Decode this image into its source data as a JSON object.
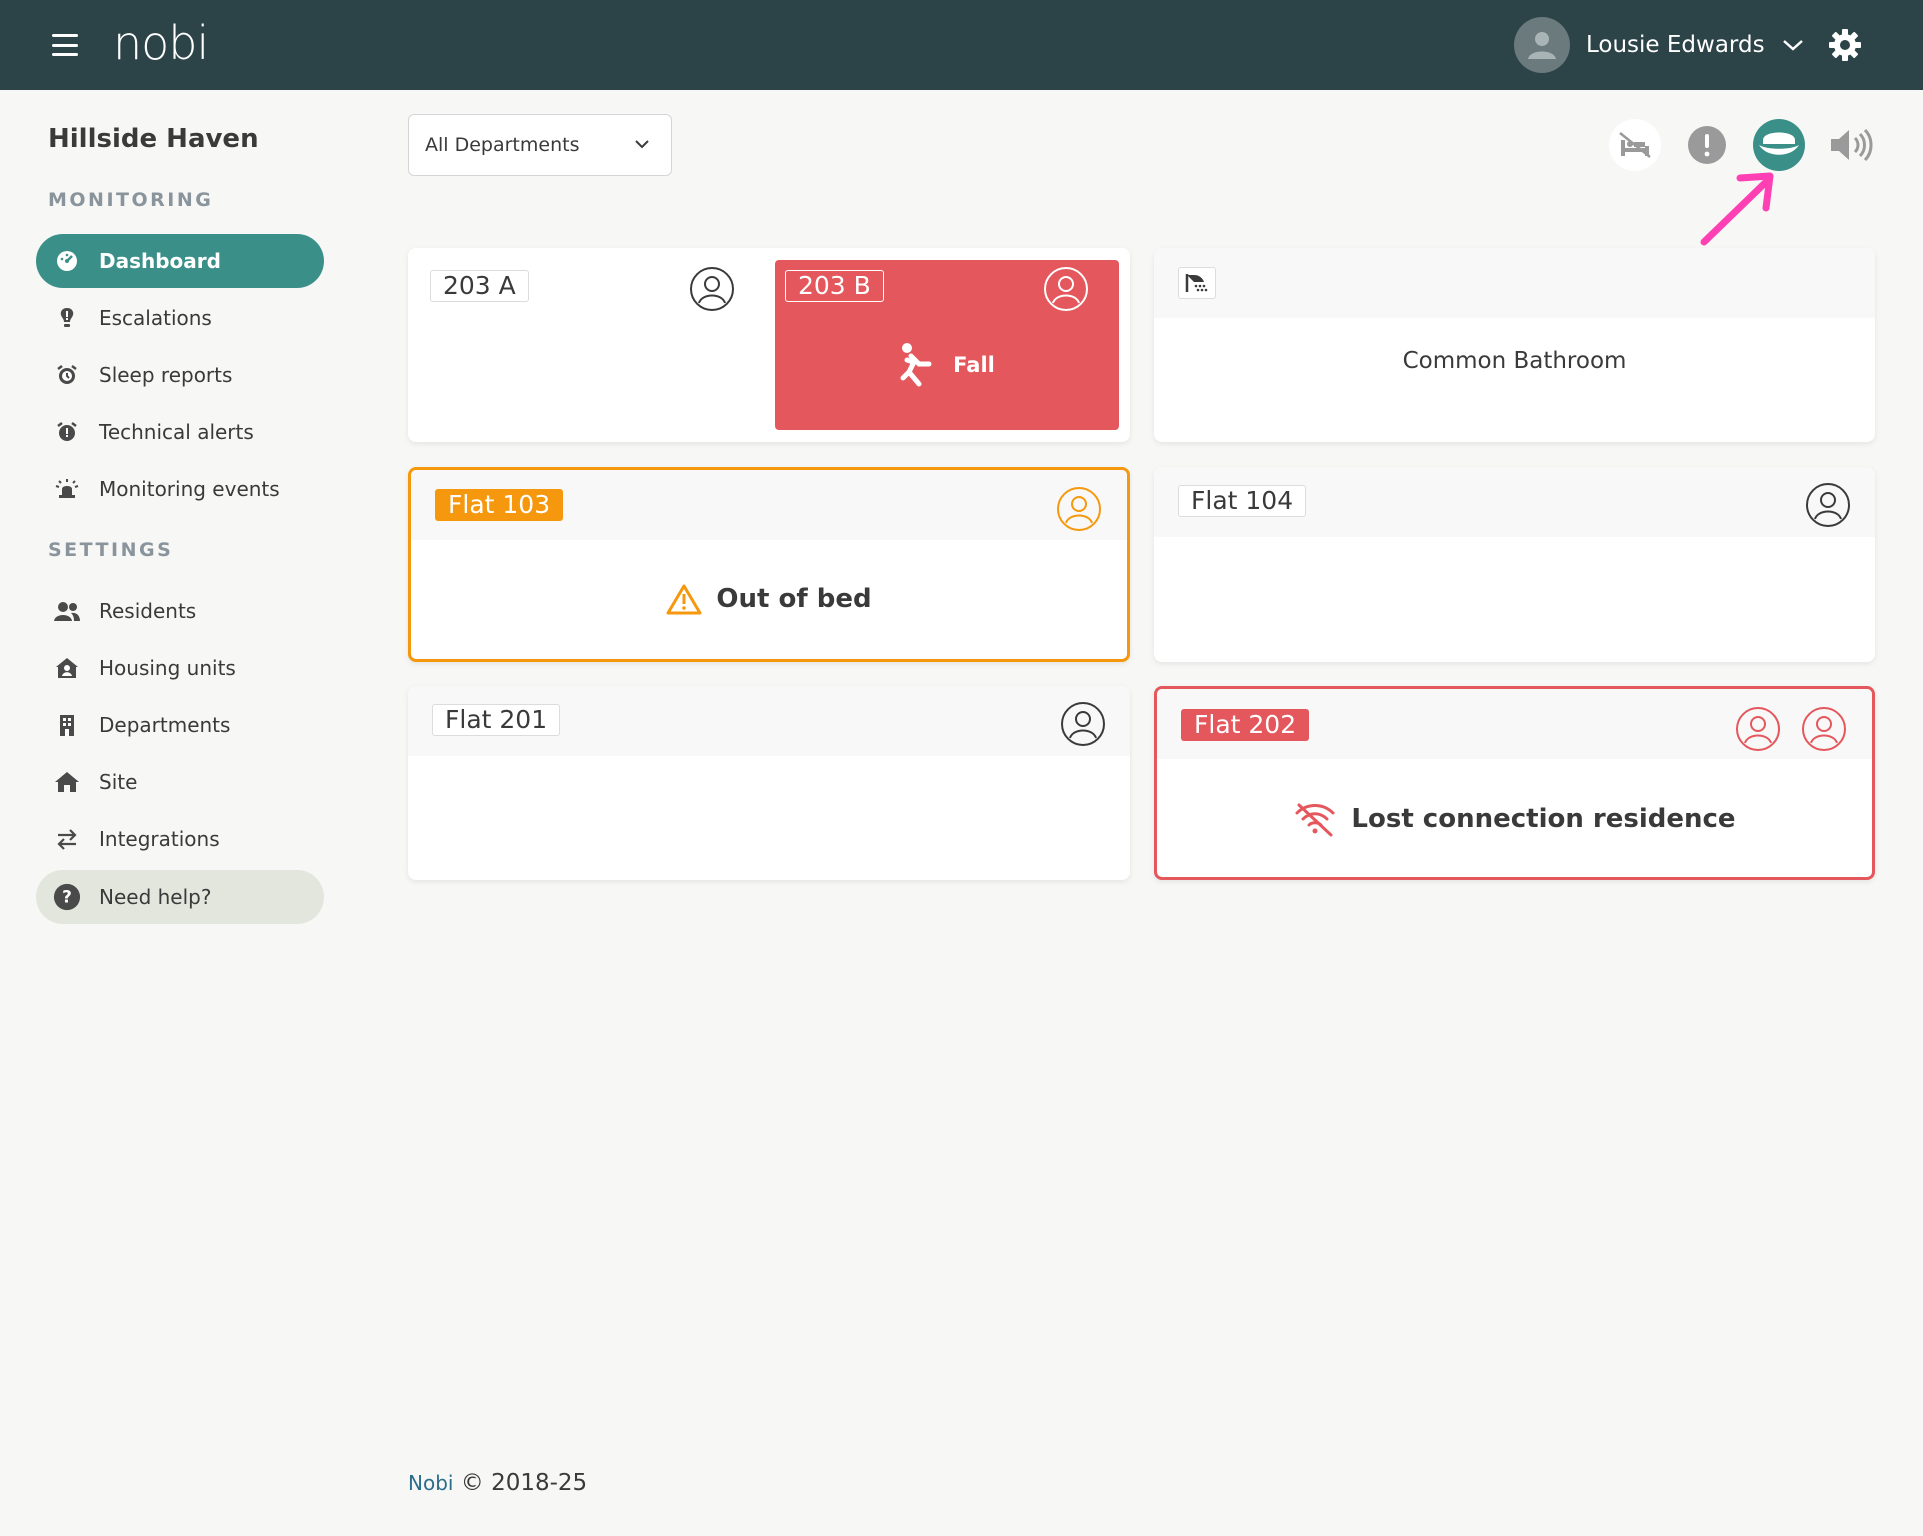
{
  "header": {
    "logo": "nobi",
    "user_name": "Lousie Edwards"
  },
  "sidebar": {
    "site_name": "Hillside Haven",
    "monitoring_title": "MONITORING",
    "settings_title": "SETTINGS",
    "monitoring_items": [
      {
        "label": "Dashboard",
        "icon": "dashboard-icon"
      },
      {
        "label": "Escalations",
        "icon": "lightbulb-alert-icon"
      },
      {
        "label": "Sleep reports",
        "icon": "alarm-clock-icon"
      },
      {
        "label": "Technical alerts",
        "icon": "alarm-alert-icon"
      },
      {
        "label": "Monitoring events",
        "icon": "siren-icon"
      }
    ],
    "settings_items": [
      {
        "label": "Residents",
        "icon": "users-icon"
      },
      {
        "label": "Housing units",
        "icon": "house-user-icon"
      },
      {
        "label": "Departments",
        "icon": "building-icon"
      },
      {
        "label": "Site",
        "icon": "home-icon"
      },
      {
        "label": "Integrations",
        "icon": "arrows-exchange-icon"
      }
    ],
    "help_label": "Need help?"
  },
  "filter": {
    "department_value": "All Departments"
  },
  "toolbar": {
    "icons": [
      "bed-off-icon",
      "exclamation-icon",
      "cap-icon",
      "volume-icon"
    ],
    "active_color": "#3a9088"
  },
  "cards": {
    "room_203a": {
      "label": "203 A"
    },
    "room_203b": {
      "label": "203 B",
      "status": "Fall",
      "color": "#e4575c"
    },
    "common_bathroom": {
      "label": "Common Bathroom"
    },
    "flat_103": {
      "label": "Flat 103",
      "status": "Out of bed",
      "color": "#f5980d"
    },
    "flat_104": {
      "label": "Flat 104"
    },
    "flat_201": {
      "label": "Flat 201"
    },
    "flat_202": {
      "label": "Flat 202",
      "status": "Lost connection residence",
      "color": "#e4575c"
    }
  },
  "footer": {
    "brand": "Nobi",
    "copyright": "© 2018-25"
  },
  "annotation": {
    "arrow_color": "#ff3fb4"
  }
}
